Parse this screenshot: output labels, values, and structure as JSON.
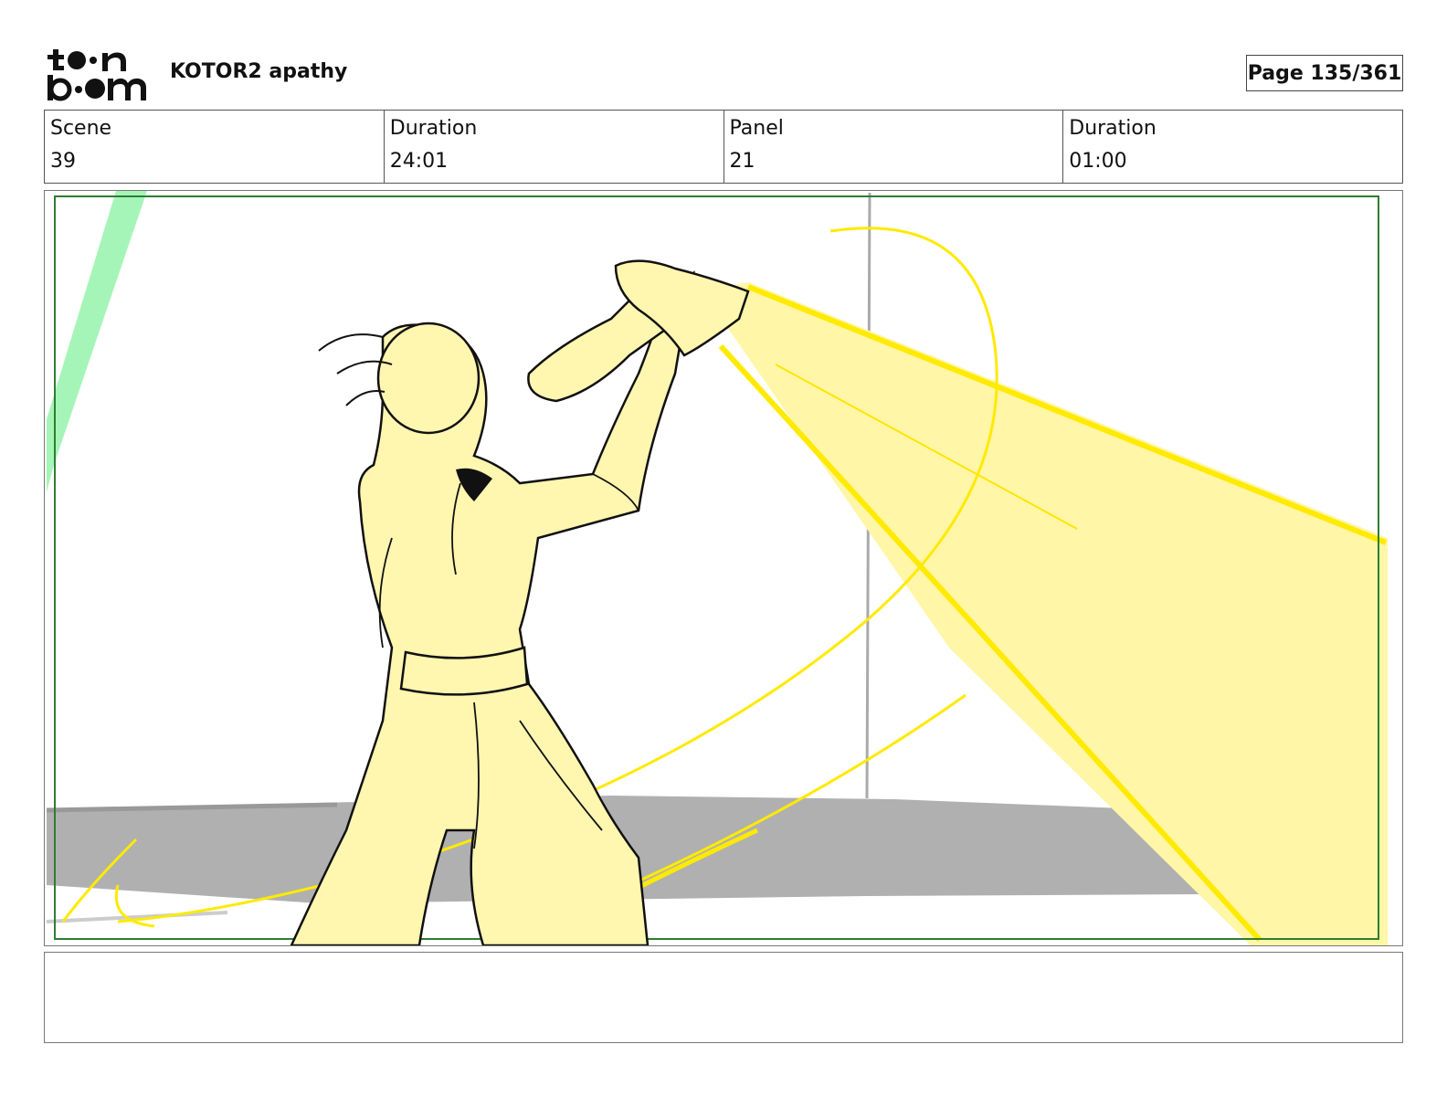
{
  "header": {
    "logo_alt": "toon boom",
    "project_title": "KOTOR2 apathy",
    "page_label": "Page 135/361"
  },
  "info": {
    "scene_label": "Scene",
    "scene_value": "39",
    "scene_duration_label": "Duration",
    "scene_duration_value": "24:01",
    "panel_label": "Panel",
    "panel_value": "21",
    "panel_duration_label": "Duration",
    "panel_duration_value": "01:00"
  },
  "panel": {
    "safe_frame_color": "#2e7d32",
    "beam_color": "#fff176",
    "line_color": "#ffea00",
    "skin_fill": "#fff6b0",
    "floor_color": "#b0b0b0",
    "green_streak": "#a6f5b8"
  },
  "notes": {
    "text": ""
  }
}
